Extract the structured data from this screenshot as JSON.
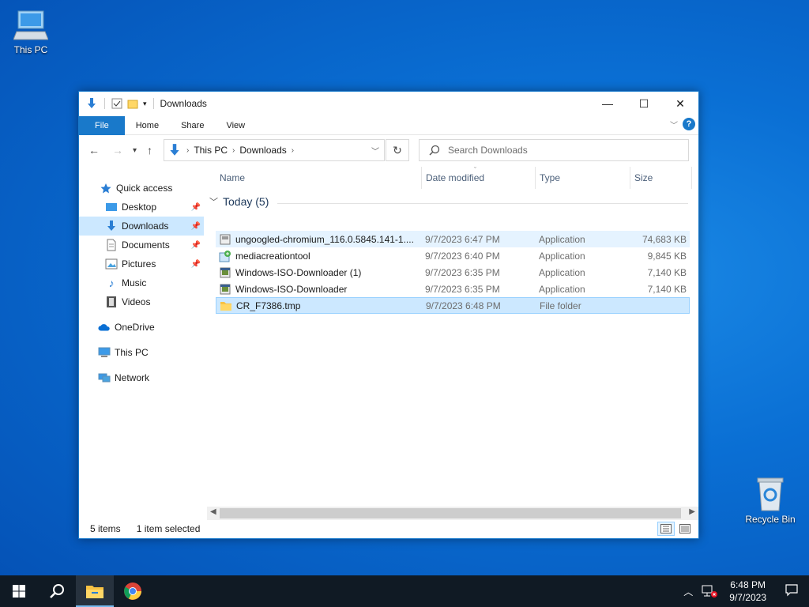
{
  "desktop": {
    "icons": [
      {
        "label": "This PC"
      },
      {
        "label": "Recycle Bin"
      }
    ]
  },
  "window": {
    "title": "Downloads",
    "controls": {
      "minimize": "—",
      "maximize": "☐",
      "close": "✕"
    }
  },
  "ribbon": {
    "tabs": [
      "File",
      "Home",
      "Share",
      "View"
    ]
  },
  "address": {
    "crumbs": [
      "This PC",
      "Downloads"
    ],
    "search_placeholder": "Search Downloads"
  },
  "navpane": {
    "items": [
      {
        "label": "Quick access",
        "icon": "star-icon"
      },
      {
        "label": "Desktop",
        "icon": "desktop-folder-icon",
        "pinned": true
      },
      {
        "label": "Downloads",
        "icon": "download-arrow-icon",
        "pinned": true,
        "selected": true
      },
      {
        "label": "Documents",
        "icon": "document-icon",
        "pinned": true
      },
      {
        "label": "Pictures",
        "icon": "picture-icon",
        "pinned": true
      },
      {
        "label": "Music",
        "icon": "music-note-icon"
      },
      {
        "label": "Videos",
        "icon": "film-icon"
      },
      {
        "label": "OneDrive",
        "icon": "cloud-icon"
      },
      {
        "label": "This PC",
        "icon": "computer-icon"
      },
      {
        "label": "Network",
        "icon": "network-icon"
      }
    ]
  },
  "columns": {
    "name": "Name",
    "date": "Date modified",
    "type": "Type",
    "size": "Size"
  },
  "group": {
    "label": "Today (5)"
  },
  "files": [
    {
      "name": "ungoogled-chromium_116.0.5845.141-1....",
      "date": "9/7/2023 6:47 PM",
      "type": "Application",
      "size": "74,683 KB",
      "icon": "installer-icon"
    },
    {
      "name": "mediacreationtool",
      "date": "9/7/2023 6:40 PM",
      "type": "Application",
      "size": "9,845 KB",
      "icon": "media-tool-icon"
    },
    {
      "name": "Windows-ISO-Downloader (1)",
      "date": "9/7/2023 6:35 PM",
      "type": "Application",
      "size": "7,140 KB",
      "icon": "app-exe-icon"
    },
    {
      "name": "Windows-ISO-Downloader",
      "date": "9/7/2023 6:35 PM",
      "type": "Application",
      "size": "7,140 KB",
      "icon": "app-exe-icon"
    },
    {
      "name": "CR_F7386.tmp",
      "date": "9/7/2023 6:48 PM",
      "type": "File folder",
      "size": "",
      "icon": "folder-icon"
    }
  ],
  "status": {
    "count": "5 items",
    "selection": "1 item selected"
  },
  "taskbar": {
    "time": "6:48 PM",
    "date": "9/7/2023"
  }
}
